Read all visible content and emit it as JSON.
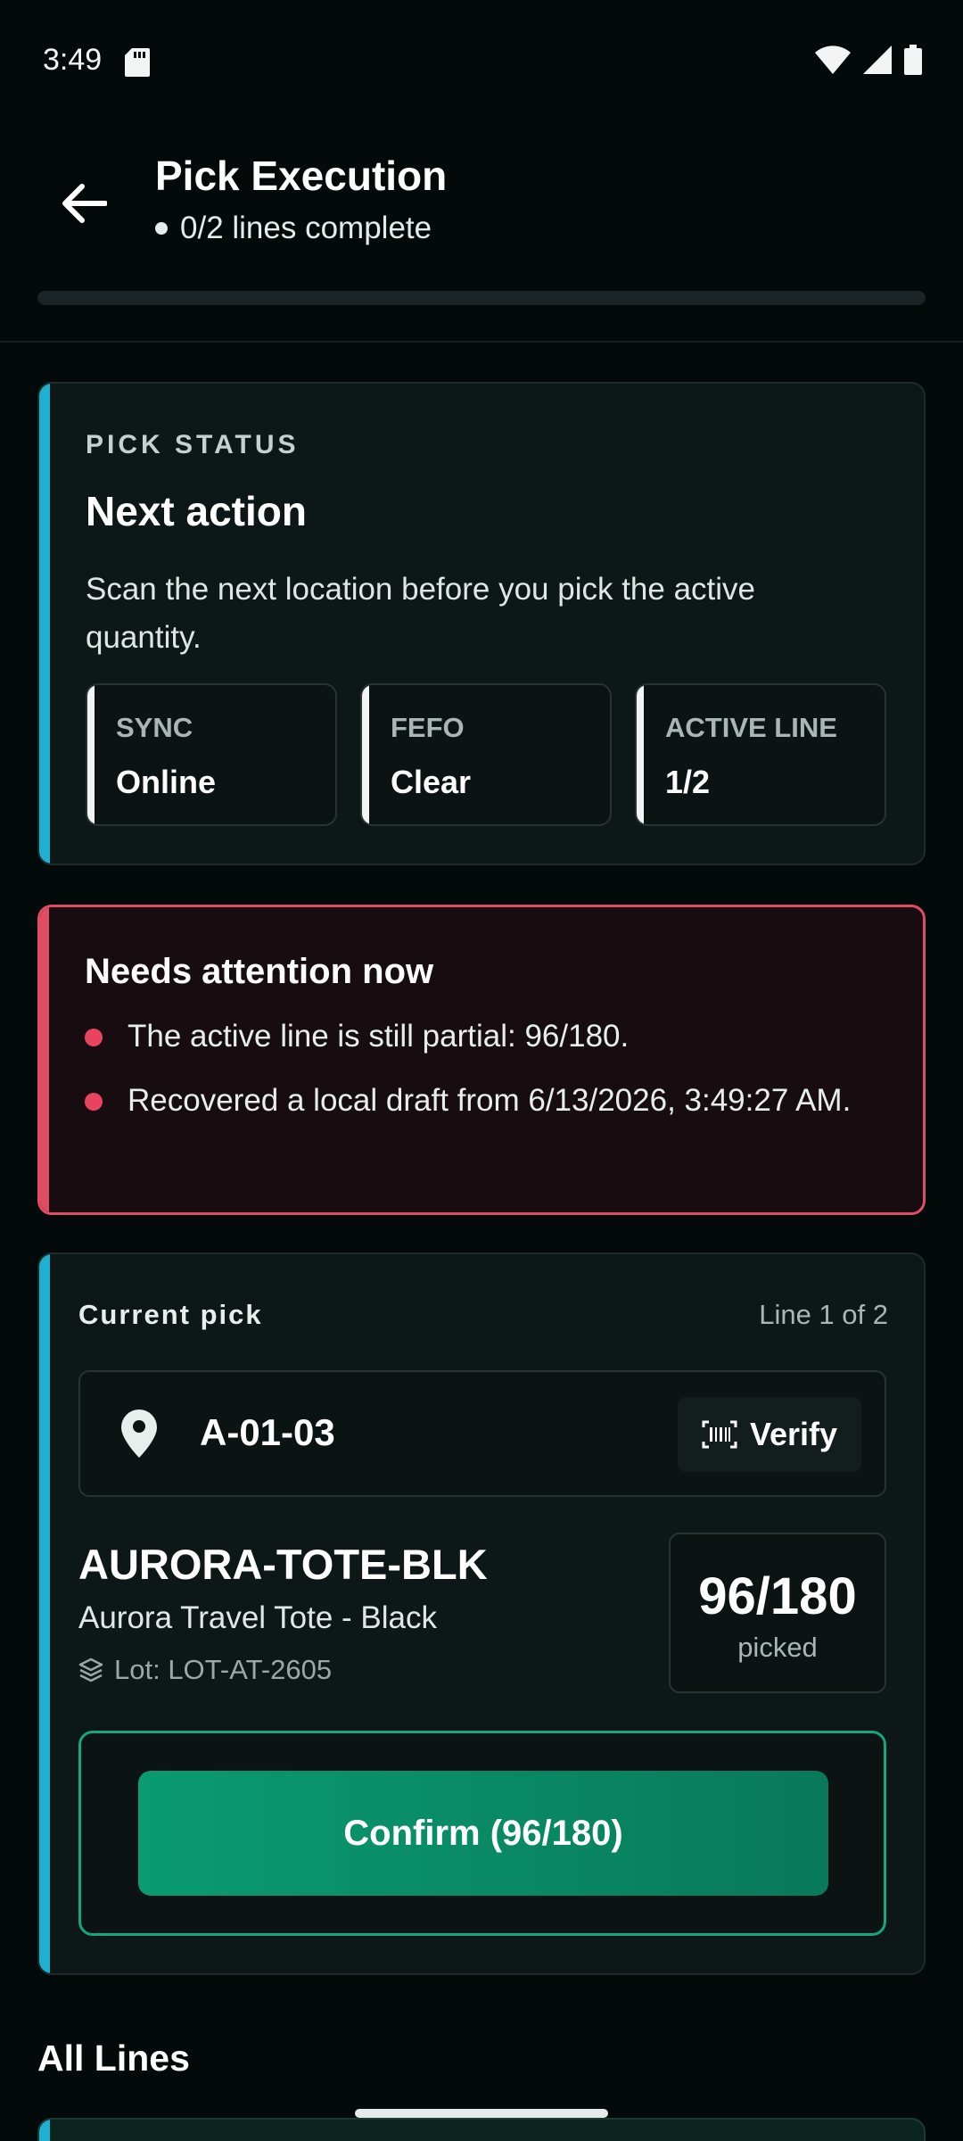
{
  "status_bar": {
    "time": "3:49"
  },
  "header": {
    "title": "Pick Execution",
    "subtitle": "0/2 lines complete",
    "progress_fraction": 0.0
  },
  "pick_status": {
    "eyebrow": "PICK STATUS",
    "title": "Next action",
    "description": "Scan the next location before you pick the active quantity.",
    "chips": [
      {
        "label": "SYNC",
        "value": "Online"
      },
      {
        "label": "FEFO",
        "value": "Clear"
      },
      {
        "label": "ACTIVE LINE",
        "value": "1/2"
      }
    ]
  },
  "attention": {
    "title": "Needs attention now",
    "items": [
      "The active line is still partial: 96/180.",
      "Recovered a local draft from 6/13/2026, 3:49:27 AM."
    ]
  },
  "current_pick": {
    "heading": "Current pick",
    "line_info": "Line 1 of 2",
    "location": "A-01-03",
    "verify_label": "Verify",
    "sku": "AURORA-TOTE-BLK",
    "product_name": "Aurora Travel Tote - Black",
    "lot": "Lot: LOT-AT-2605",
    "quantity": "96/180",
    "quantity_label": "picked",
    "confirm_label": "Confirm (96/180)"
  },
  "all_lines": {
    "title": "All Lines"
  },
  "colors": {
    "accent_cyan": "#1fb0d0",
    "alert_red": "#e04c66",
    "confirm_green": "#0a9b70",
    "background": "#040909"
  },
  "icons": [
    "sd-card-icon",
    "wifi-icon",
    "signal-icon",
    "battery-icon",
    "back-arrow-icon",
    "location-pin-icon",
    "barcode-icon",
    "layers-icon"
  ]
}
